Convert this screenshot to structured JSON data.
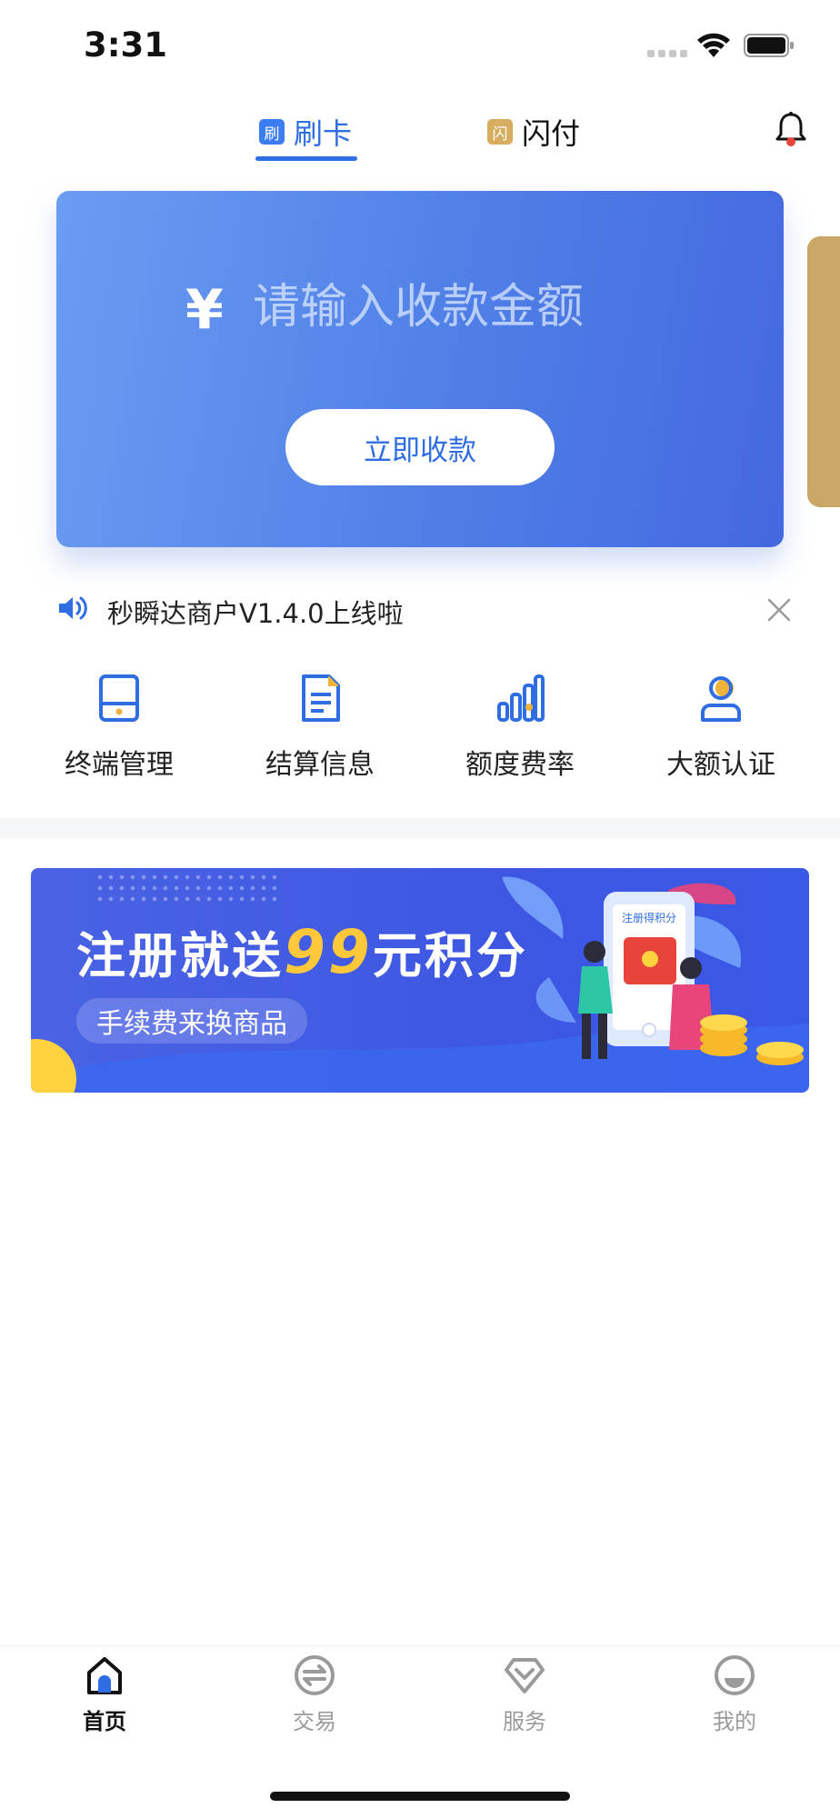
{
  "status_bar": {
    "time": "3:31"
  },
  "top_tabs": [
    {
      "badge": "刷",
      "label": "刷卡",
      "active": true
    },
    {
      "badge": "闪",
      "label": "闪付",
      "active": false
    }
  ],
  "hero": {
    "currency_symbol": "¥",
    "amount_placeholder": "请输入收款金额",
    "collect_button": "立即收款"
  },
  "notice": {
    "text": "秒瞬达商户V1.4.0上线啦"
  },
  "shortcuts": [
    {
      "label": "终端管理",
      "icon": "terminal-icon"
    },
    {
      "label": "结算信息",
      "icon": "document-icon"
    },
    {
      "label": "额度费率",
      "icon": "bar-chart-icon"
    },
    {
      "label": "大额认证",
      "icon": "user-verify-icon"
    }
  ],
  "banner": {
    "title_prefix": "注册就送",
    "title_number": "99",
    "title_suffix": "元积分",
    "subtitle": "手续费来换商品",
    "phone_screen_text": "注册得积分"
  },
  "tabbar": [
    {
      "label": "首页",
      "icon": "home-icon",
      "active": true
    },
    {
      "label": "交易",
      "icon": "exchange-icon",
      "active": false
    },
    {
      "label": "服务",
      "icon": "diamond-icon",
      "active": false
    },
    {
      "label": "我的",
      "icon": "profile-icon",
      "active": false
    }
  ],
  "colors": {
    "primary": "#2f6de3",
    "gold": "#d7ad5f",
    "banner_highlight": "#ffc83a"
  }
}
